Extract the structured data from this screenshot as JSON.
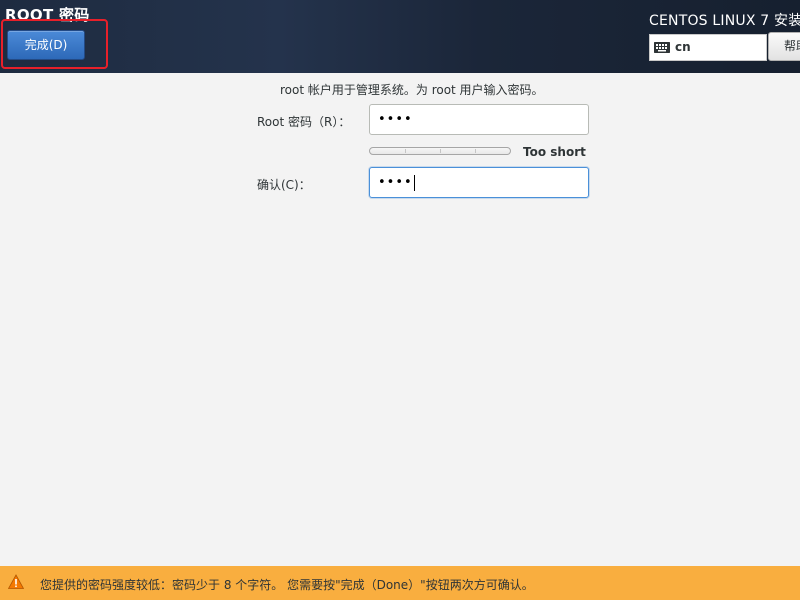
{
  "header": {
    "title": "ROOT 密码",
    "done_label": "完成(D)",
    "installer_title": "CENTOS LINUX 7 安装",
    "keyboard_layout": "cn",
    "help_label": "帮助！"
  },
  "form": {
    "intro": "root 帐户用于管理系统。为 root 用户输入密码。",
    "root_password_label": "Root 密码（R）：",
    "root_password_value": "••••",
    "strength_label": "Too short",
    "strength_level": 0,
    "confirm_label": "确认(C)：",
    "confirm_value": "••••"
  },
  "warning": {
    "text": "您提供的密码强度较低：密码少于 8 个字符。 您需要按\"完成（Done）\"按钮两次方可确认。",
    "color": "#f9ae3f"
  },
  "colors": {
    "header_bg": "#1e2b40",
    "done_button": "#3a79c9",
    "highlight": "#e8202a"
  },
  "icons": {
    "keyboard": "keyboard-icon",
    "warning": "warning-icon"
  }
}
